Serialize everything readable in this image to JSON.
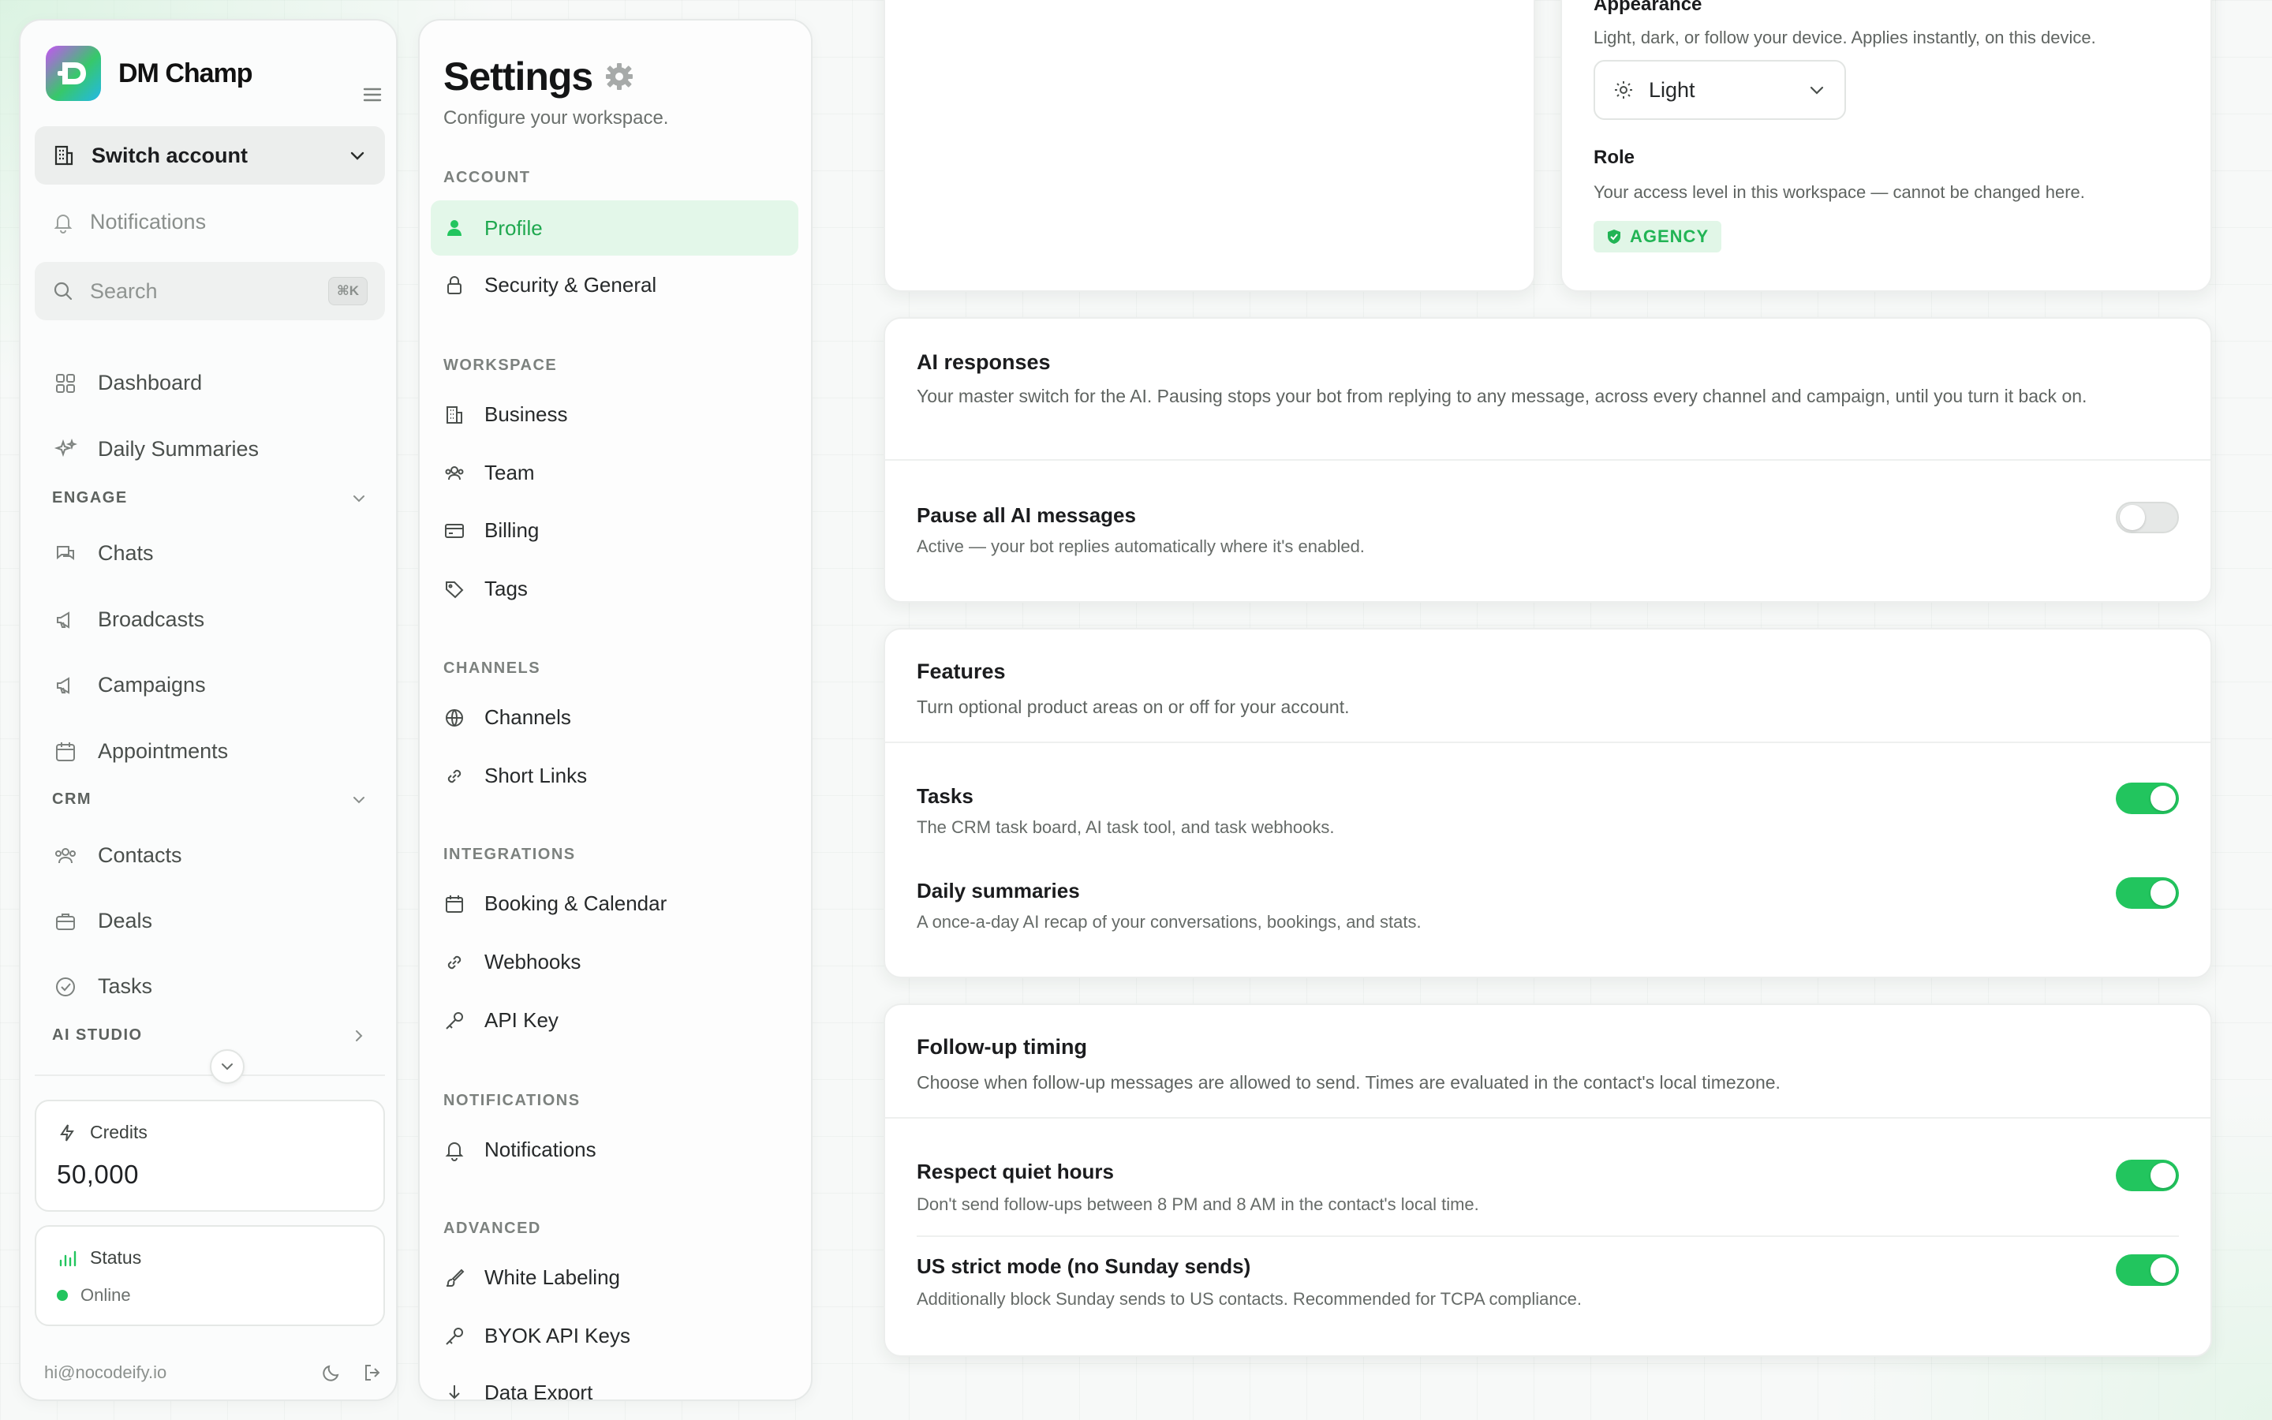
{
  "brand": {
    "name": "DM Champ"
  },
  "sidebar": {
    "switch_account": "Switch account",
    "notifications": "Notifications",
    "search_placeholder": "Search",
    "search_shortcut": "⌘K",
    "items_top": [
      {
        "label": "Dashboard",
        "icon": "dashboard-icon"
      },
      {
        "label": "Daily Summaries",
        "icon": "sparkles-icon"
      }
    ],
    "sections": {
      "engage": "ENGAGE",
      "crm": "CRM",
      "ai_studio": "AI STUDIO"
    },
    "engage_items": [
      {
        "label": "Chats",
        "icon": "chat-icon"
      },
      {
        "label": "Broadcasts",
        "icon": "megaphone-icon"
      },
      {
        "label": "Campaigns",
        "icon": "megaphone-icon"
      },
      {
        "label": "Appointments",
        "icon": "calendar-icon"
      }
    ],
    "crm_items": [
      {
        "label": "Contacts",
        "icon": "users-icon"
      },
      {
        "label": "Deals",
        "icon": "briefcase-icon"
      },
      {
        "label": "Tasks",
        "icon": "check-circle-icon"
      }
    ],
    "credits": {
      "label": "Credits",
      "value": "50,000"
    },
    "status": {
      "label": "Status",
      "value": "Online"
    },
    "footer_email": "hi@nocodeify.io"
  },
  "settings": {
    "title": "Settings",
    "subtitle": "Configure your workspace.",
    "groups": {
      "account": "ACCOUNT",
      "workspace": "WORKSPACE",
      "channels": "CHANNELS",
      "integrations": "INTEGRATIONS",
      "notifications": "NOTIFICATIONS",
      "advanced": "ADVANCED"
    },
    "items": {
      "profile": "Profile",
      "security": "Security & General",
      "business": "Business",
      "team": "Team",
      "billing": "Billing",
      "tags": "Tags",
      "channels": "Channels",
      "short_links": "Short Links",
      "booking": "Booking & Calendar",
      "webhooks": "Webhooks",
      "api_key": "API Key",
      "notifications": "Notifications",
      "white_labeling": "White Labeling",
      "byok": "BYOK API Keys",
      "data_export": "Data Export"
    }
  },
  "appearance": {
    "title": "Appearance",
    "description": "Light, dark, or follow your device. Applies instantly, on this device.",
    "selected": "Light",
    "role_title": "Role",
    "role_description": "Your access level in this workspace — cannot be changed here.",
    "role_badge": "AGENCY"
  },
  "ai_responses": {
    "title": "AI responses",
    "description": "Your master switch for the AI. Pausing stops your bot from replying to any message, across every channel and campaign, until you turn it back on.",
    "pause_title": "Pause all AI messages",
    "pause_description": "Active — your bot replies automatically where it's enabled.",
    "pause_on": false
  },
  "features": {
    "title": "Features",
    "description": "Turn optional product areas on or off for your account.",
    "tasks_title": "Tasks",
    "tasks_description": "The CRM task board, AI task tool, and task webhooks.",
    "tasks_on": true,
    "summaries_title": "Daily summaries",
    "summaries_description": "A once-a-day AI recap of your conversations, bookings, and stats.",
    "summaries_on": true
  },
  "followup": {
    "title": "Follow-up timing",
    "description": "Choose when follow-up messages are allowed to send. Times are evaluated in the contact's local timezone.",
    "quiet_title": "Respect quiet hours",
    "quiet_description": "Don't send follow-ups between 8 PM and 8 AM in the contact's local time.",
    "quiet_on": true,
    "us_title": "US strict mode (no Sunday sends)",
    "us_description": "Additionally block Sunday sends to US contacts. Recommended for TCPA compliance.",
    "us_on": true
  },
  "colors": {
    "accent": "#22c55e",
    "accent_bg": "#e3f7e9"
  }
}
